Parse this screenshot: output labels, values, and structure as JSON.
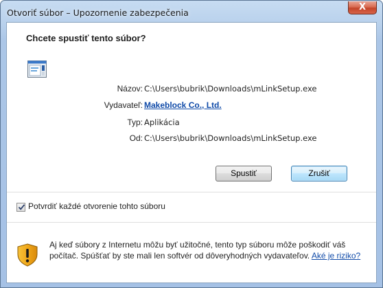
{
  "window": {
    "title": "Otvoriť súbor – Upozornenie zabezpečenia",
    "close_glyph": "X"
  },
  "dialog": {
    "heading": "Chcete spustiť tento súbor?",
    "fields": [
      {
        "label": "Názov:",
        "value": "C:\\Users\\bubrik\\Downloads\\mLinkSetup.exe"
      },
      {
        "label": "Vydavateľ:",
        "value": "Makeblock Co., Ltd."
      },
      {
        "label": "Typ:",
        "value": "Aplikácia"
      },
      {
        "label": "Od:",
        "value": "C:\\Users\\bubrik\\Downloads\\mLinkSetup.exe"
      }
    ],
    "buttons": {
      "run": "Spustiť",
      "cancel": "Zrušiť"
    },
    "checkbox": {
      "label": "Potvrdiť každé otvorenie tohto súboru",
      "checked": true
    },
    "warning": {
      "text": "Aj keď súbory z Internetu môžu byť užitočné, tento typ súboru môže poškodiť váš počítač. Spúšťať by ste mali len softvér od dôveryhodných vydavateľov.",
      "link": "Aké je riziko?"
    }
  }
}
